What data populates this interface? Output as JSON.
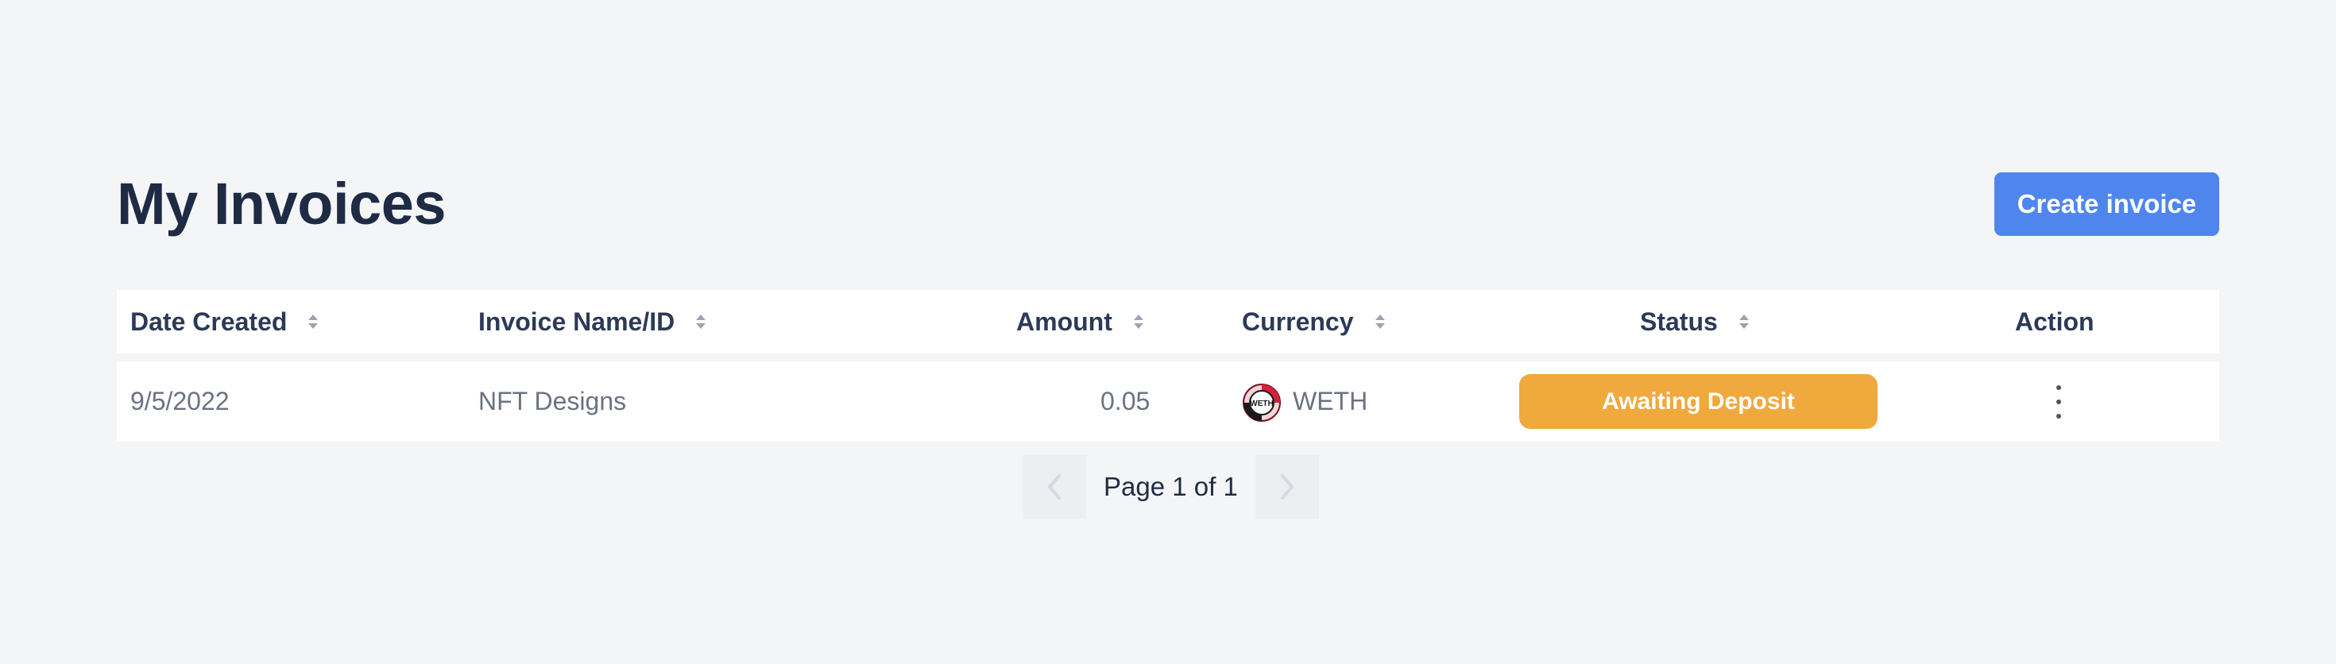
{
  "header": {
    "title": "My Invoices",
    "create_label": "Create invoice"
  },
  "table": {
    "columns": [
      "Date Created",
      "Invoice Name/ID",
      "Amount",
      "Currency",
      "Status",
      "Action"
    ],
    "rows": [
      {
        "date": "9/5/2022",
        "name": "NFT Designs",
        "amount": "0.05",
        "currency": "WETH",
        "currency_logo_text": "WETH",
        "status": "Awaiting Deposit"
      }
    ]
  },
  "pagination": {
    "label": "Page 1 of 1"
  },
  "colors": {
    "accent": "#4f86ee",
    "status_awaiting": "#f0a93c",
    "background": "#f4f5f7"
  },
  "icons": {
    "sort": "sort-icon",
    "prev": "chevron-left-icon",
    "next": "chevron-right-icon",
    "action": "more-vertical-icon",
    "currency": "weth-logo-icon"
  }
}
